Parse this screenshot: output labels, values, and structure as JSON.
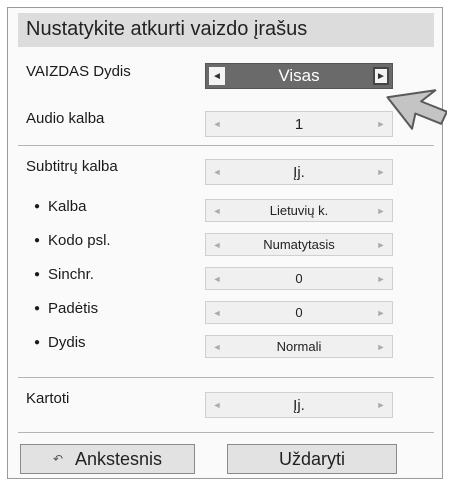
{
  "panel": {
    "title": "Nustatykite atkurti vaizdo įrašus"
  },
  "rows": {
    "vaizdas": {
      "label": "VAIZDAS Dydis",
      "value": "Visas"
    },
    "audio": {
      "label": "Audio kalba",
      "value": "1"
    },
    "subtitrai": {
      "label": "Subtitrų kalba",
      "value": "Įj."
    },
    "kalba": {
      "label": "Kalba",
      "value": "Lietuvių k."
    },
    "kodo": {
      "label": "Kodo psl.",
      "value": "Numatytasis"
    },
    "sinchr": {
      "label": "Sinchr.",
      "value": "0"
    },
    "padetis": {
      "label": "Padėtis",
      "value": "0"
    },
    "dydis": {
      "label": "Dydis",
      "value": "Normali"
    },
    "kartoti": {
      "label": "Kartoti",
      "value": "Įj."
    }
  },
  "arrows": {
    "left": "◄",
    "right": "►"
  },
  "buttons": {
    "back_label": "Ankstesnis",
    "back_icon": "back-arrow-icon",
    "back_icon_glyph": "↶",
    "close_label": "Uždaryti"
  },
  "colors": {
    "active_selector": "#6a6a6a",
    "title_bar": "#dcdcdc"
  },
  "icons": {
    "cursor": "pointer-arrow-icon"
  }
}
